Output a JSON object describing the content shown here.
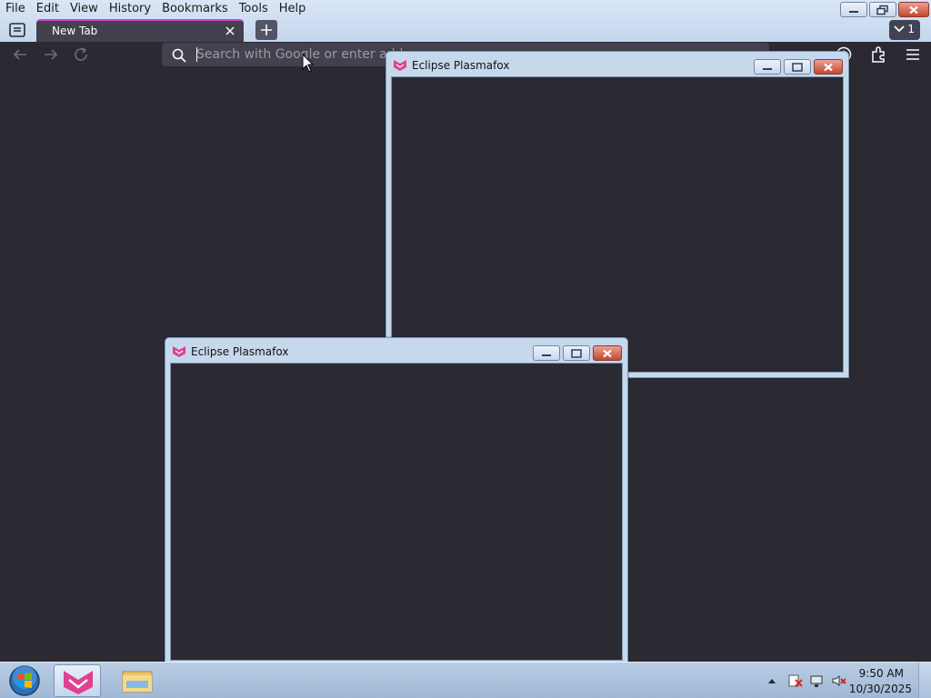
{
  "menubar": {
    "items": [
      {
        "label": "File"
      },
      {
        "label": "Edit"
      },
      {
        "label": "View"
      },
      {
        "label": "History"
      },
      {
        "label": "Bookmarks"
      },
      {
        "label": "Tools"
      },
      {
        "label": "Help"
      }
    ]
  },
  "tabs": {
    "active": {
      "title": "New Tab"
    },
    "overflow_count": "1"
  },
  "urlbar": {
    "placeholder": "Search with Google or enter address",
    "value": ""
  },
  "popups": [
    {
      "title": "Eclipse Plasmafox"
    },
    {
      "title": "Eclipse Plasmafox"
    }
  ],
  "taskbar": {
    "clock_time": "9:50 AM",
    "clock_date": "10/30/2025"
  },
  "colors": {
    "accent": "#d047d8",
    "content_bg": "#2b2a33",
    "urlbar_bg": "#42414d",
    "brand_pink": "#e0408f"
  },
  "icons": [
    "app-menu-icon",
    "back-arrow-icon",
    "forward-arrow-icon",
    "reload-icon",
    "search-icon",
    "extensions-icon",
    "hamburger-menu-icon",
    "windows-start-orb",
    "plasmafox-logo",
    "file-explorer-icon"
  ]
}
